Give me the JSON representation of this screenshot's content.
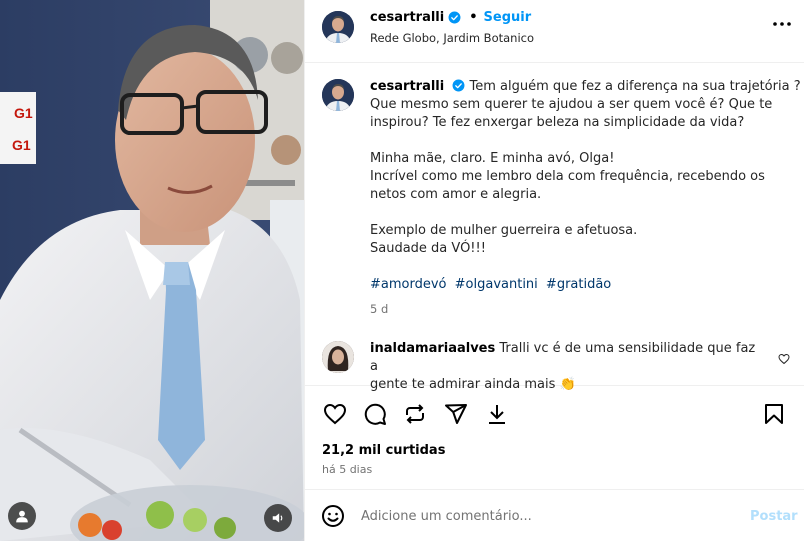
{
  "post": {
    "username": "cesartralli",
    "follow_label": "Seguir",
    "separator": "•",
    "location": "Rede Globo, Jardim Botanico",
    "more_icon": "more-horizontal-icon"
  },
  "caption": {
    "username": "cesartralli",
    "lines": [
      "Tem alguém que fez a diferença na sua trajetória ?",
      "Que mesmo sem querer te ajudou a ser quem você é? Que te",
      "inspirou? Te fez enxergar beleza na simplicidade da vida?",
      "",
      "Minha mãe, claro. E minha avó, Olga!",
      "Incrível como me lembro dela com frequência, recebendo os",
      "netos com amor e alegria.",
      "",
      "Exemplo de mulher guerreira e afetuosa.",
      "Saudade da VÓ!!!"
    ],
    "hashtags": [
      "#amordevó",
      "#olgavantini",
      "#gratidão"
    ],
    "age": "5 d"
  },
  "comments": [
    {
      "username": "inaldamariaalves",
      "text_line1": "Tralli vc é de uma sensibilidade que faz a",
      "text_line2": "gente te admirar ainda mais 👏"
    }
  ],
  "actions": {
    "icons": [
      "heart-icon",
      "comment-icon",
      "share-icon",
      "send-icon",
      "download-icon",
      "bookmark-icon"
    ]
  },
  "stats": {
    "likes": "21,2 mil curtidas",
    "posted": "há 5 dias"
  },
  "composer": {
    "placeholder": "Adicione um comentário...",
    "post_label": "Postar"
  },
  "media": {
    "background_signs": [
      "G1",
      "G1"
    ]
  },
  "colors": {
    "accent": "#0095f6",
    "hashtag": "#00376b",
    "post_disabled": "#b2dffc",
    "muted": "#737373",
    "verified": "#0095f6"
  }
}
